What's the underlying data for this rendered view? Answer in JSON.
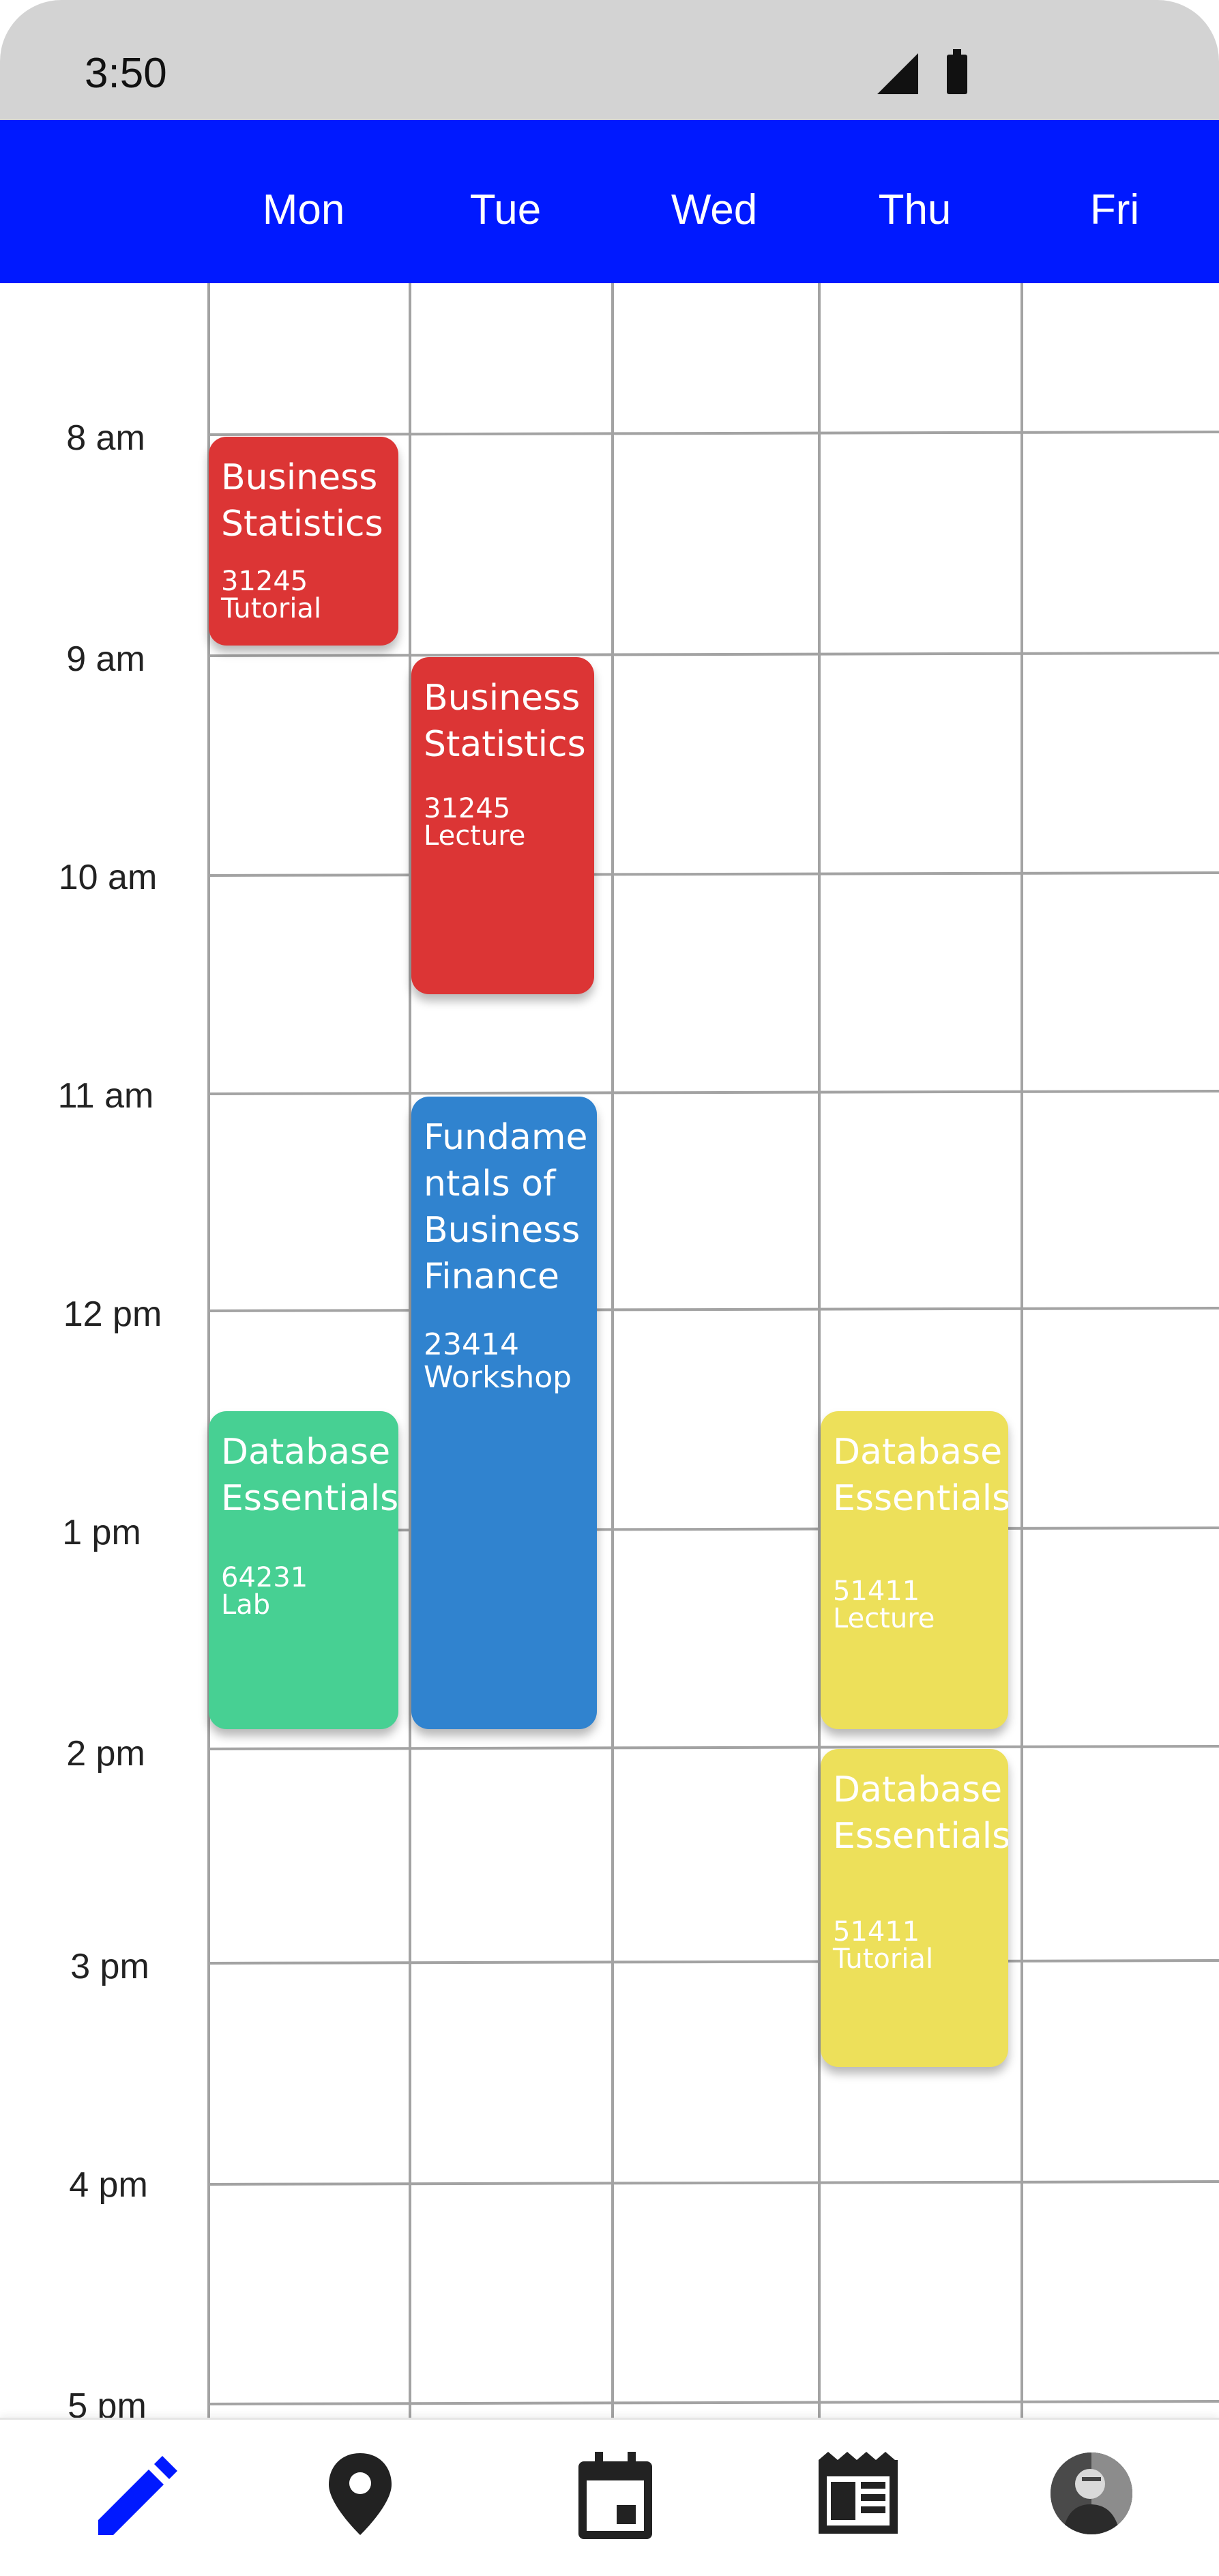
{
  "status_bar": {
    "time": "3:50"
  },
  "days": [
    "Mon",
    "Tue",
    "Wed",
    "Thu",
    "Fri"
  ],
  "times": [
    "8 am",
    "9 am",
    "10 am",
    "11 am",
    "12 pm",
    "1 pm",
    "2 pm",
    "3 pm",
    "4 pm",
    "5 pm"
  ],
  "events": [
    {
      "title": "Business Statistics",
      "code": "31245",
      "type": "Tutorial",
      "color": "#dc3535"
    },
    {
      "title": "Business Statistics",
      "code": "31245",
      "type": "Lecture",
      "color": "#dc3535"
    },
    {
      "title": "Fundame ntals of Business Finance",
      "code": "23414",
      "type": "Workshop",
      "color": "#3083cf"
    },
    {
      "title": "Database Essentials",
      "code": "64231",
      "type": "Lab",
      "color": "#47d093"
    },
    {
      "title": "Database Essentials",
      "code": "51411",
      "type": "Lecture",
      "color": "#ede05a"
    },
    {
      "title": "Database Essentials",
      "code": "51411",
      "type": "Tutorial",
      "color": "#ede05a"
    }
  ],
  "nav": {
    "items": [
      "pencil-icon",
      "location-pin-icon",
      "calendar-icon",
      "news-icon",
      "profile-avatar"
    ],
    "active_color": "#0019ff"
  },
  "colors": {
    "header": "#0019ff",
    "status_bar": "#d3d3d3"
  }
}
